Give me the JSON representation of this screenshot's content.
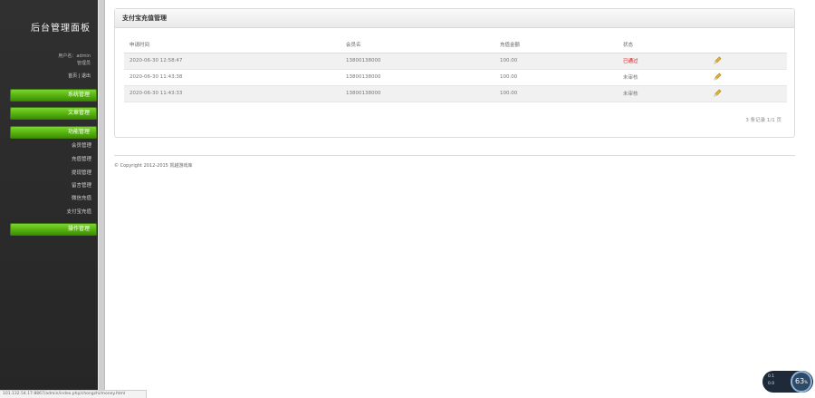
{
  "sidebar": {
    "brand": "后台管理面板",
    "user_label": "用户名：admin",
    "role_label": "管理员",
    "links_label": "首页 | 退出",
    "nav": [
      {
        "label": "系统管理"
      },
      {
        "label": "文章管理"
      },
      {
        "label": "功能管理"
      },
      {
        "label": "操作管理"
      }
    ],
    "sub_items": [
      {
        "label": "会员管理"
      },
      {
        "label": "充值管理"
      },
      {
        "label": "提现管理"
      },
      {
        "label": "留言管理"
      },
      {
        "label": "微信充值"
      },
      {
        "label": "支付宝充值"
      }
    ]
  },
  "panel": {
    "title": "支付宝充值管理",
    "columns": [
      "申请时间",
      "会员名",
      "充值金额",
      "状态"
    ],
    "rows": [
      {
        "time": "2020-06-30 12:58:47",
        "member": "13800138000",
        "amount": "100.00",
        "status": "已通过",
        "status_color": "#cc1111"
      },
      {
        "time": "2020-06-30 11:43:38",
        "member": "13800138000",
        "amount": "100.00",
        "status": "未审核",
        "status_color": "#777777"
      },
      {
        "time": "2020-06-30 11:43:33",
        "member": "13800138000",
        "amount": "100.00",
        "status": "未审核",
        "status_color": "#777777"
      }
    ],
    "pager": "3 条记录 1/1 页"
  },
  "footer": {
    "copyright": "© Copyright 2012-2015 凯越游戏库"
  },
  "status_bar": {
    "url": "101.132.54.17:8867/admin/index.php/chongzhi/money.html"
  },
  "meter": {
    "up": "0.1",
    "down": "0.0",
    "percent": "63"
  },
  "colors": {
    "accent_green": "#56b10f",
    "sidebar_bg": "#2b2b2b"
  }
}
